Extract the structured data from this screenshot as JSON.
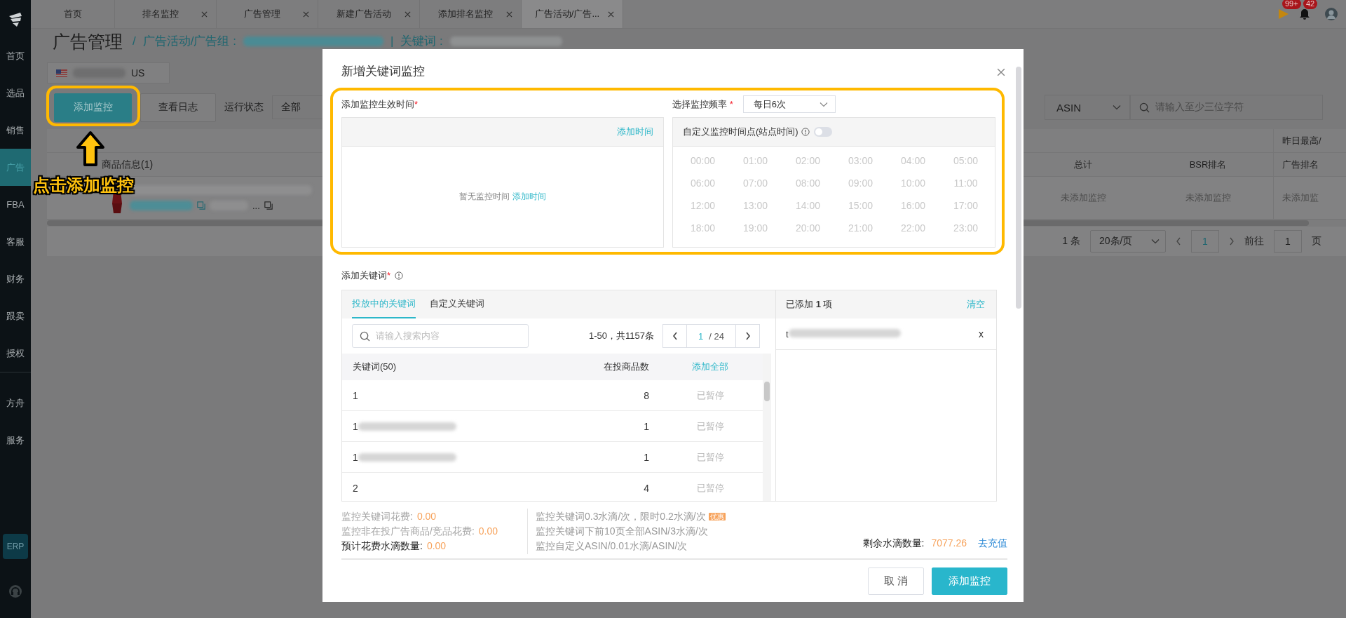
{
  "sidebar": {
    "primary_items": [
      {
        "label": "首页",
        "selected": false
      },
      {
        "label": "选品",
        "selected": false
      },
      {
        "label": "销售",
        "selected": false
      },
      {
        "label": "广告",
        "selected": true
      },
      {
        "label": "FBA",
        "selected": false
      },
      {
        "label": "客服",
        "selected": false
      },
      {
        "label": "财务",
        "selected": false
      },
      {
        "label": "跟卖",
        "selected": false
      },
      {
        "label": "授权",
        "selected": false
      }
    ],
    "secondary_items": [
      {
        "label": "方舟",
        "selected": false
      },
      {
        "label": "服务",
        "selected": false
      }
    ],
    "erp_label": "ERP"
  },
  "tabs": [
    {
      "label": "首页",
      "selected": false,
      "closable": false
    },
    {
      "label": "排名监控",
      "selected": false,
      "closable": true
    },
    {
      "label": "广告管理",
      "selected": false,
      "closable": true
    },
    {
      "label": "新建广告活动",
      "selected": false,
      "closable": true
    },
    {
      "label": "添加排名监控",
      "selected": false,
      "closable": true
    },
    {
      "label": "广告活动/广告...",
      "selected": true,
      "closable": true
    }
  ],
  "notifications": {
    "flag_count": "99+",
    "bell_count": "42"
  },
  "page": {
    "title": "广告管理",
    "breadcrumb_separator": "/",
    "breadcrumb": "广告活动/广告组 :",
    "keyword_separator": "|",
    "keyword_label": "关键词 :",
    "marketplace": "US",
    "buttons": [
      {
        "label": "添加监控",
        "kind": "primary"
      },
      {
        "label": "查看日志",
        "kind": "default"
      }
    ],
    "status_label": "运行状态",
    "status_value": "全部",
    "search_type": "ASIN",
    "search_placeholder": "请输入至少三位字符",
    "table": {
      "group_header": "昨日最高/",
      "product_column": "商品信息(1)",
      "columns": [
        "总计",
        "BSR排名",
        "广告排名"
      ],
      "product_ellipsis": "...",
      "cells": [
        "未添加监控",
        "未添加监控",
        "未添加监"
      ]
    },
    "pagination": {
      "total": "1 条",
      "page_size": "20条/页",
      "page": "1",
      "goto_label": "前往",
      "goto_value": "1",
      "page_suffix": "页"
    }
  },
  "annotation": {
    "text": "点击添加监控"
  },
  "modal": {
    "title": "新增关键词监控",
    "schedule": {
      "label": "添加监控生效时间",
      "required_mark": "*",
      "add_link": "添加时间",
      "empty_text": "暂无监控时间",
      "empty_link": "添加时间"
    },
    "frequency": {
      "label": "选择监控频率",
      "required_mark": "*",
      "value": "每日6次",
      "custom_label": "自定义监控时间点(站点时间)",
      "custom_on": false,
      "times": [
        "00:00",
        "01:00",
        "02:00",
        "03:00",
        "04:00",
        "05:00",
        "06:00",
        "07:00",
        "08:00",
        "09:00",
        "10:00",
        "11:00",
        "12:00",
        "13:00",
        "14:00",
        "15:00",
        "16:00",
        "17:00",
        "18:00",
        "19:00",
        "20:00",
        "21:00",
        "22:00",
        "23:00"
      ]
    },
    "keywords": {
      "label": "添加关键词",
      "required_mark": "*",
      "tabs": [
        {
          "label": "投放中的关键词",
          "selected": true
        },
        {
          "label": "自定义关键词",
          "selected": false
        }
      ],
      "search_placeholder": "请输入搜索内容",
      "range": "1-50，共1157条",
      "page": "1",
      "page_total": "/ 24",
      "columns": [
        "关键词(50)",
        "在投商品数"
      ],
      "add_all": "添加全部",
      "rows": [
        {
          "keyword": "1",
          "redacted": false,
          "count": "8",
          "status": "已暂停"
        },
        {
          "keyword": "1",
          "redacted": true,
          "count": "1",
          "status": "已暂停"
        },
        {
          "keyword": "1",
          "redacted": true,
          "count": "1",
          "status": "已暂停"
        },
        {
          "keyword": "2",
          "redacted": false,
          "count": "4",
          "status": "已暂停"
        }
      ],
      "selected_header": "已添加 **1** 项",
      "clear": "清空",
      "selected_items": [
        {
          "keyword": "t",
          "redacted": true,
          "remove": "x"
        }
      ]
    },
    "costs": [
      {
        "label": "监控关键词花费:",
        "value": "0.00",
        "emphasis": false
      },
      {
        "label": "监控非在投广告商品/竞品花费:",
        "value": "0.00",
        "emphasis": false
      },
      {
        "label": "预计花费水滴数量:",
        "value": "0.00",
        "emphasis": true
      }
    ],
    "rates": [
      {
        "text": "监控关键词0.3水滴/次，限时0.2水滴/次",
        "badge": "优惠"
      },
      {
        "text": "监控关键词下前10页全部ASIN/3水滴/次"
      },
      {
        "text": "监控自定义ASIN/0.01水滴/ASIN/次"
      }
    ],
    "balance_label": "剩余水滴数量:",
    "balance": "7077.26",
    "recharge": "去充值",
    "cancel": "取 消",
    "confirm": "添加监控"
  }
}
